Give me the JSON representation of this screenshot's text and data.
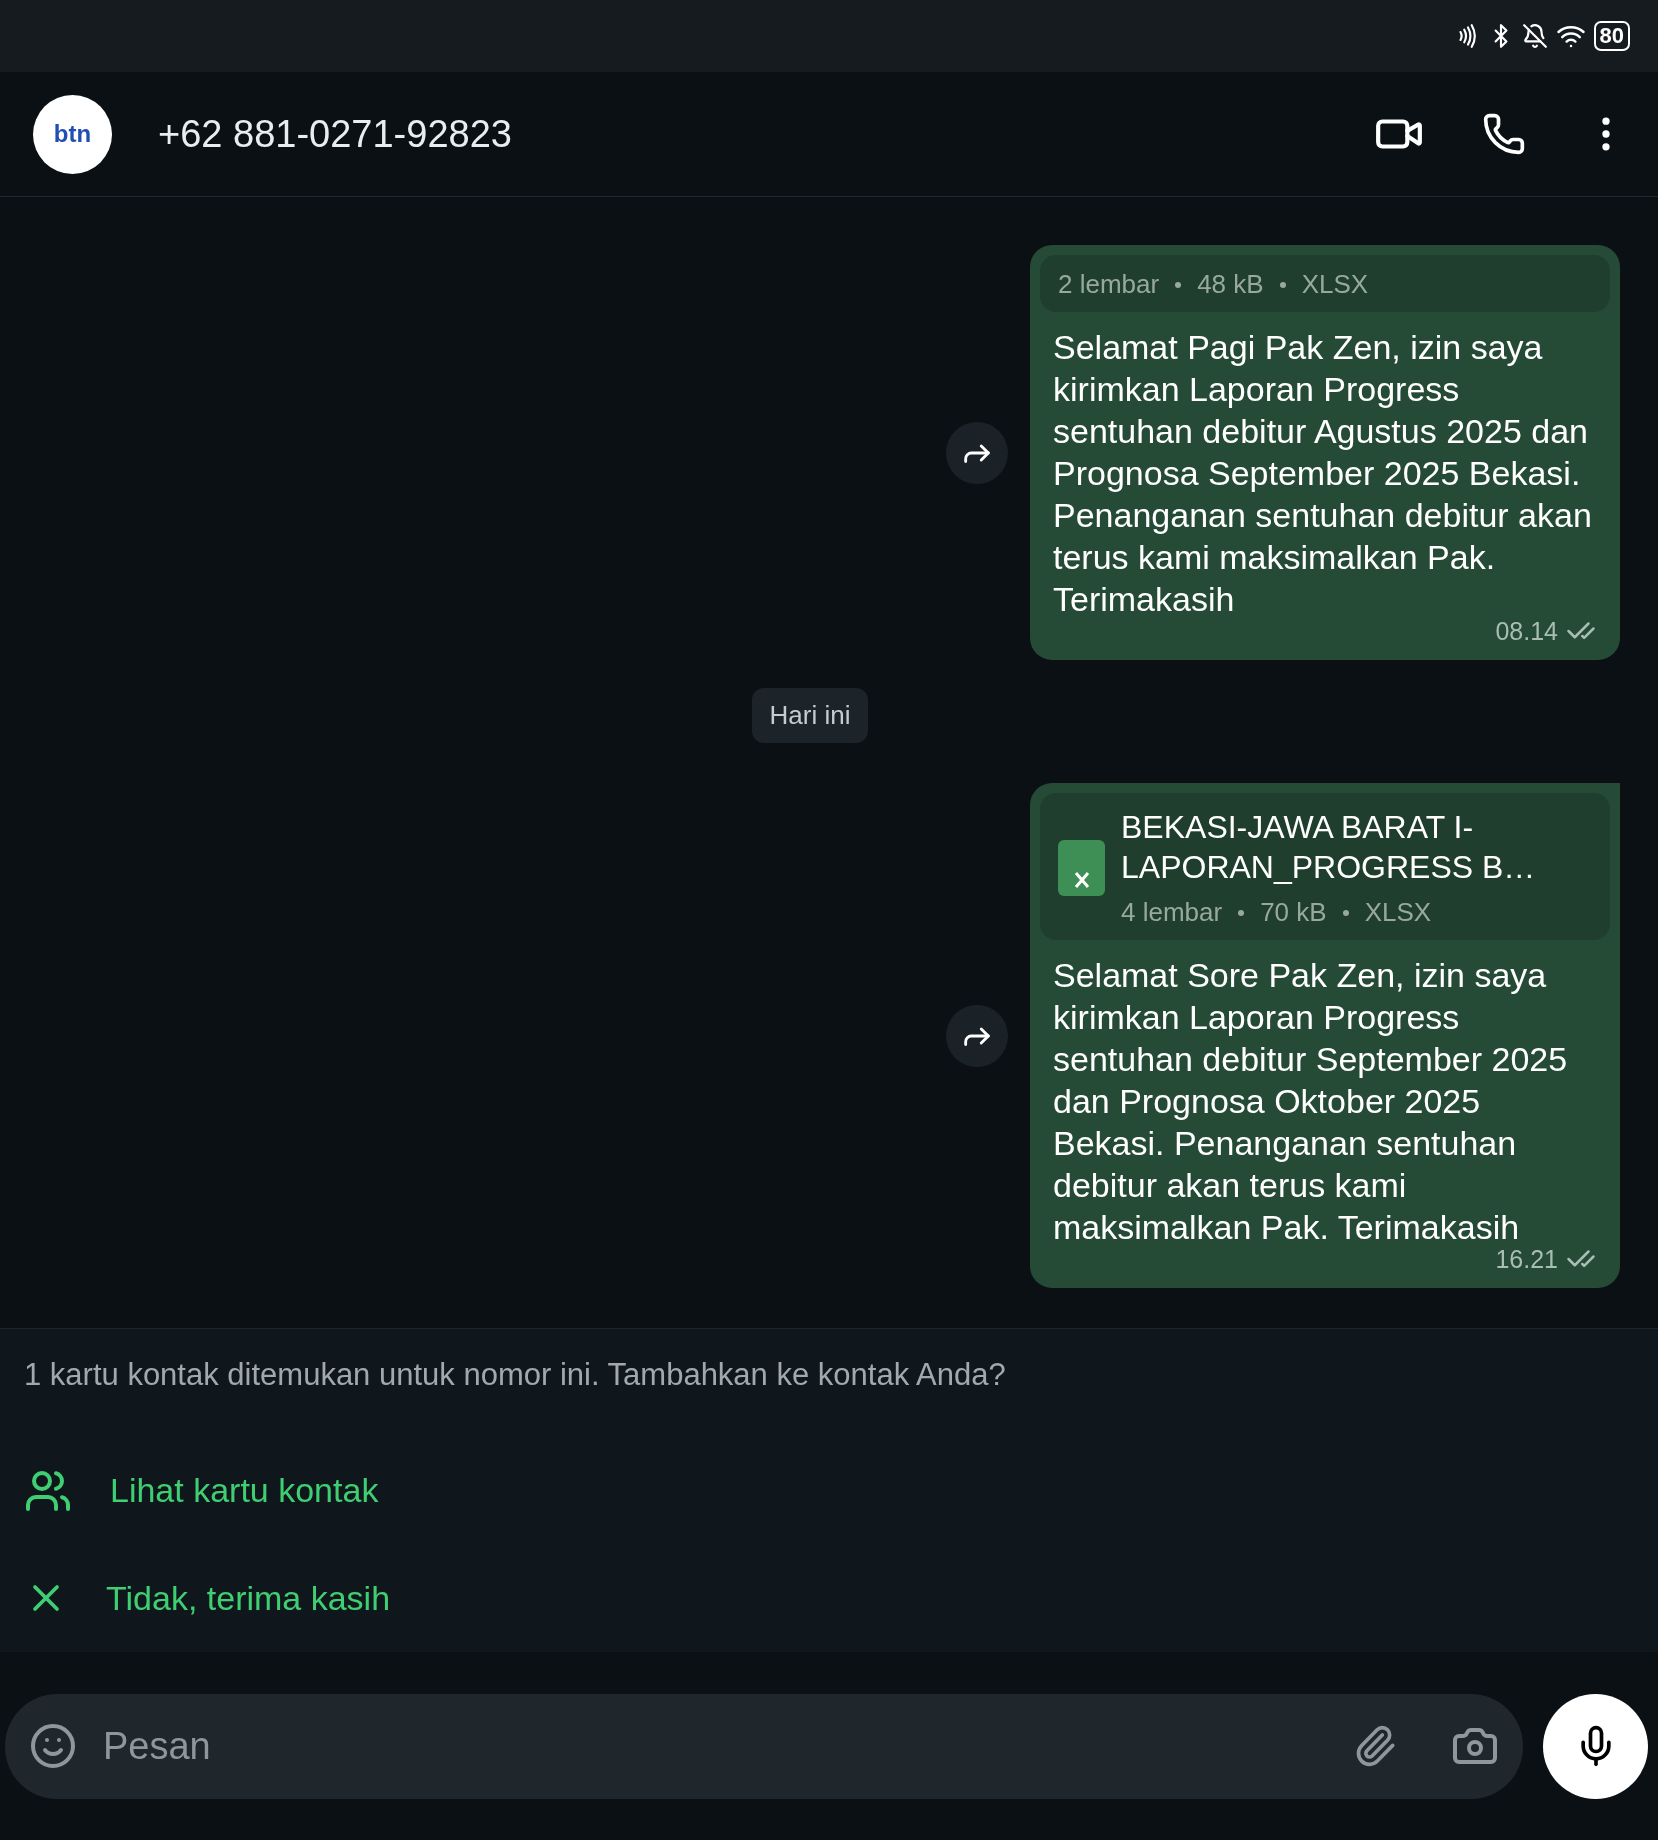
{
  "status_bar": {
    "battery": "80"
  },
  "header": {
    "avatar_text": "btn",
    "title": "+62 881-0271-92823"
  },
  "messages": [
    {
      "kind": "file_message",
      "file": {
        "meta": [
          "2 lembar",
          "48 kB",
          "XLSX"
        ]
      },
      "text": "Selamat Pagi Pak Zen, izin saya kirimkan Laporan Progress sentuhan debitur Agustus 2025 dan Prognosa September 2025 Bekasi. Penanganan sentuhan debitur akan terus kami maksimalkan Pak. Terimakasih",
      "time": "08.14",
      "read": true,
      "tail": false
    },
    {
      "kind": "date",
      "text": "Hari ini"
    },
    {
      "kind": "file_message",
      "file": {
        "name": "BEKASI-JAWA BARAT I-LAPORAN_PROGRESS B…",
        "meta": [
          "4 lembar",
          "70 kB",
          "XLSX"
        ]
      },
      "text": "Selamat Sore Pak Zen, izin saya kirimkan Laporan Progress sentuhan debitur September 2025 dan Prognosa Oktober 2025 Bekasi. Penanganan sentuhan debitur akan terus kami maksimalkan Pak. Terimakasih",
      "time": "16.21",
      "read": true,
      "tail": true
    }
  ],
  "contact_prompt": {
    "text": "1 kartu kontak ditemukan untuk nomor ini. Tambahkan ke kontak Anda?",
    "actions": [
      {
        "kind": "view",
        "label": "Lihat kartu kontak"
      },
      {
        "kind": "dismiss",
        "label": "Tidak, terima kasih"
      }
    ]
  },
  "composer": {
    "placeholder": "Pesan"
  }
}
